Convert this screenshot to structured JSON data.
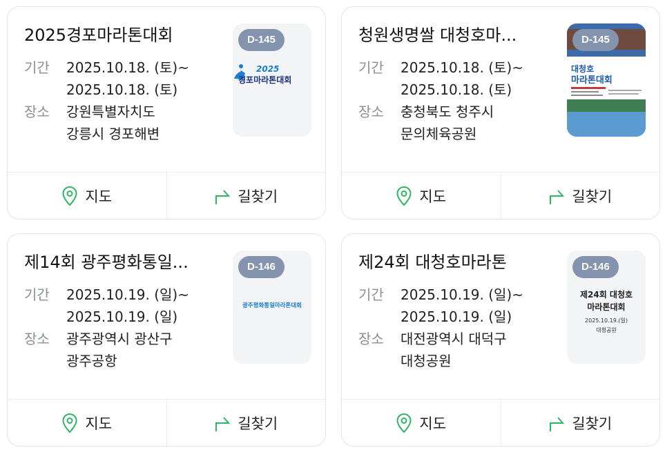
{
  "labels": {
    "period": "기간",
    "place": "장소",
    "map": "지도",
    "directions": "길찾기"
  },
  "colors": {
    "badge": "#8493ae",
    "icon_green": "#2db560",
    "label_gray": "#8a8f96"
  },
  "events": [
    {
      "title": "2025경포마라톤대회",
      "date_start": "2025.10.18. (토)~",
      "date_end": "2025.10.18. (토)",
      "place_1": "강원특별자치도",
      "place_2": "강릉시 경포해변",
      "dday": "D-145",
      "poster_text": "2025 경포마라톤대회",
      "poster_year": "2025",
      "poster_name": "경포마라톤대회"
    },
    {
      "title": "청원생명쌀 대청호마...",
      "date_start": "2025.10.18. (토)~",
      "date_end": "2025.10.18. (토)",
      "place_1": "충청북도 청주시",
      "place_2": "문의체육공원",
      "dday": "D-145",
      "poster_line1": "대청호",
      "poster_line2": "마라톤대회"
    },
    {
      "title": "제14회 광주평화통일...",
      "date_start": "2025.10.19. (일)~",
      "date_end": "2025.10.19. (일)",
      "place_1": "광주광역시 광산구",
      "place_2": "광주공항",
      "dday": "D-146",
      "poster_text": "광주평화통일마라톤대회"
    },
    {
      "title": "제24회 대청호마라톤",
      "date_start": "2025.10.19. (일)~",
      "date_end": "2025.10.19. (일)",
      "place_1": "대전광역시 대덕구",
      "place_2": "대청공원",
      "dday": "D-146",
      "poster_line1": "제24회 대청호",
      "poster_line2": "마라톤대회",
      "poster_date": "2025.10.19.(일)",
      "poster_place": "대청공원"
    }
  ]
}
